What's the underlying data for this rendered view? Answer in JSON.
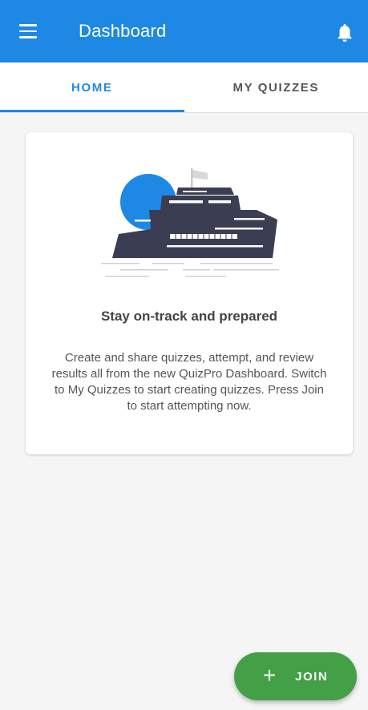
{
  "app_bar": {
    "title": "Dashboard",
    "menu_icon": "hamburger-menu-icon",
    "notification_icon": "bell-icon",
    "color": "#1e88e5"
  },
  "tabs": [
    {
      "label": "HOME",
      "active": true
    },
    {
      "label": "MY QUIZZES",
      "active": false
    }
  ],
  "card": {
    "illustration": "ship-illustration",
    "title": "Stay on-track and prepared",
    "body": "Create and share quizzes, attempt, and review results all from the new QuizPro Dashboard. Switch to My Quizzes to start creating quizzes. Press Join to start attempting now."
  },
  "fab": {
    "icon": "plus-icon",
    "icon_glyph": "+",
    "label": "JOIN",
    "color": "#43a047"
  }
}
